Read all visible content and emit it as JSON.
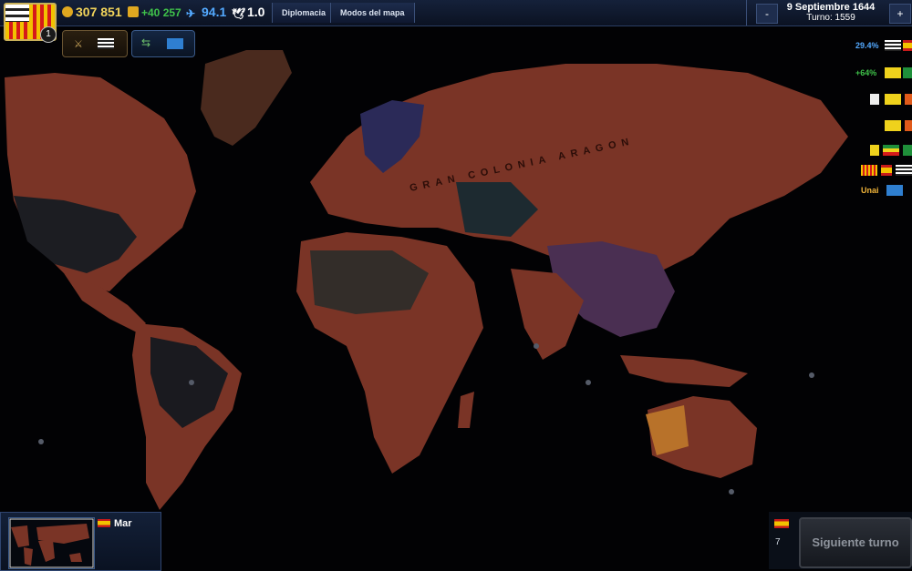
{
  "resources": {
    "gold": "307 851",
    "income": "+40 257",
    "manpower": "94.1",
    "stability": "1.0"
  },
  "player": {
    "notification_count": "1"
  },
  "menu": {
    "diplomacy": "Diplomacia",
    "map_modes": "Modos del mapa"
  },
  "date": {
    "date": "9 Septiembre 1644",
    "turn": "Turno: 1559",
    "zoom_out": "-",
    "zoom_in": "+"
  },
  "relations": [
    {
      "label": "29.4%",
      "color": "#53a9ff"
    },
    {
      "label": "+64%",
      "color": "#3fc24a"
    },
    {
      "label": "",
      "color": "#ffffff"
    },
    {
      "label": "",
      "color": "#ffffff"
    },
    {
      "label": "",
      "color": "#ffffff"
    },
    {
      "label": "",
      "color": "#ffffff"
    },
    {
      "label": "Unai",
      "color": "#f2b53a"
    }
  ],
  "map_labels": [
    "GRAN COLONIA ARAGON"
  ],
  "minimap": {
    "location": "Mar"
  },
  "bottom": {
    "count": "7",
    "next_turn": "Siguiente turno"
  },
  "colors": {
    "territory": "#7a3426",
    "ocean": "#020204",
    "accent": "#c9b15a"
  }
}
